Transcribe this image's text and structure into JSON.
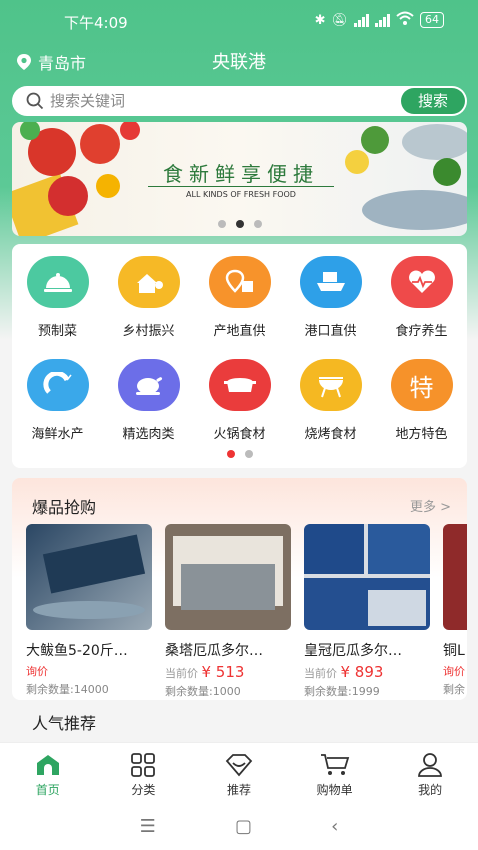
{
  "status": {
    "time": "下午4:09",
    "battery": "64"
  },
  "header": {
    "city": "青岛市",
    "title": "央联港"
  },
  "search": {
    "placeholder": "搜索关键词",
    "button": "搜索"
  },
  "banner": {
    "title": "食新鲜享便捷",
    "subtitle": "ALL KINDS OF FRESH FOOD"
  },
  "categories": [
    {
      "label": "预制菜",
      "color": "#4cc9a0"
    },
    {
      "label": "乡村振兴",
      "color": "#f6b926"
    },
    {
      "label": "产地直供",
      "color": "#f7932b"
    },
    {
      "label": "港口直供",
      "color": "#2ea0e8"
    },
    {
      "label": "食疗养生",
      "color": "#ef4a4a"
    },
    {
      "label": "海鲜水产",
      "color": "#3aa8ea"
    },
    {
      "label": "精选肉类",
      "color": "#6c6ee8"
    },
    {
      "label": "火锅食材",
      "color": "#ea3c3c"
    },
    {
      "label": "烧烤食材",
      "color": "#f5b822"
    },
    {
      "label": "地方特色",
      "color": "#f6922a"
    }
  ],
  "hot": {
    "title": "爆品抢购",
    "more": "更多 >",
    "products": [
      {
        "name": "大鲅鱼5-20斤…",
        "ask": "询价",
        "stock": "剩余数量:14000"
      },
      {
        "name": "桑塔厄瓜多尔…",
        "price_prefix": "当前价",
        "price": "¥ 513",
        "stock": "剩余数量:1000"
      },
      {
        "name": "皇冠厄瓜多尔…",
        "price_prefix": "当前价",
        "price": "¥ 893",
        "stock": "剩余数量:1999"
      },
      {
        "name": "铜L",
        "ask": "询价",
        "stock": "剩余"
      }
    ]
  },
  "recommend": {
    "title": "人气推荐"
  },
  "tabs": [
    {
      "label": "首页"
    },
    {
      "label": "分类"
    },
    {
      "label": "推荐"
    },
    {
      "label": "购物单"
    },
    {
      "label": "我的"
    }
  ],
  "colors": {
    "brand": "#4fc38a",
    "button": "#2ea561",
    "price": "#e33333"
  }
}
